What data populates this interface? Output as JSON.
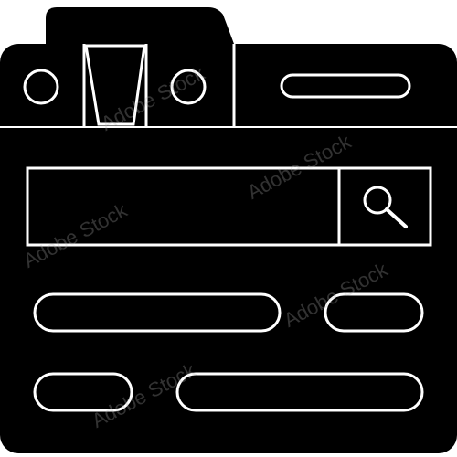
{
  "icon": {
    "name": "browser-window-with-search-icon",
    "fill": "#000000",
    "stroke": "#ffffff"
  },
  "watermark": {
    "text": "Adobe Stock"
  },
  "stock_id": "#215241252"
}
